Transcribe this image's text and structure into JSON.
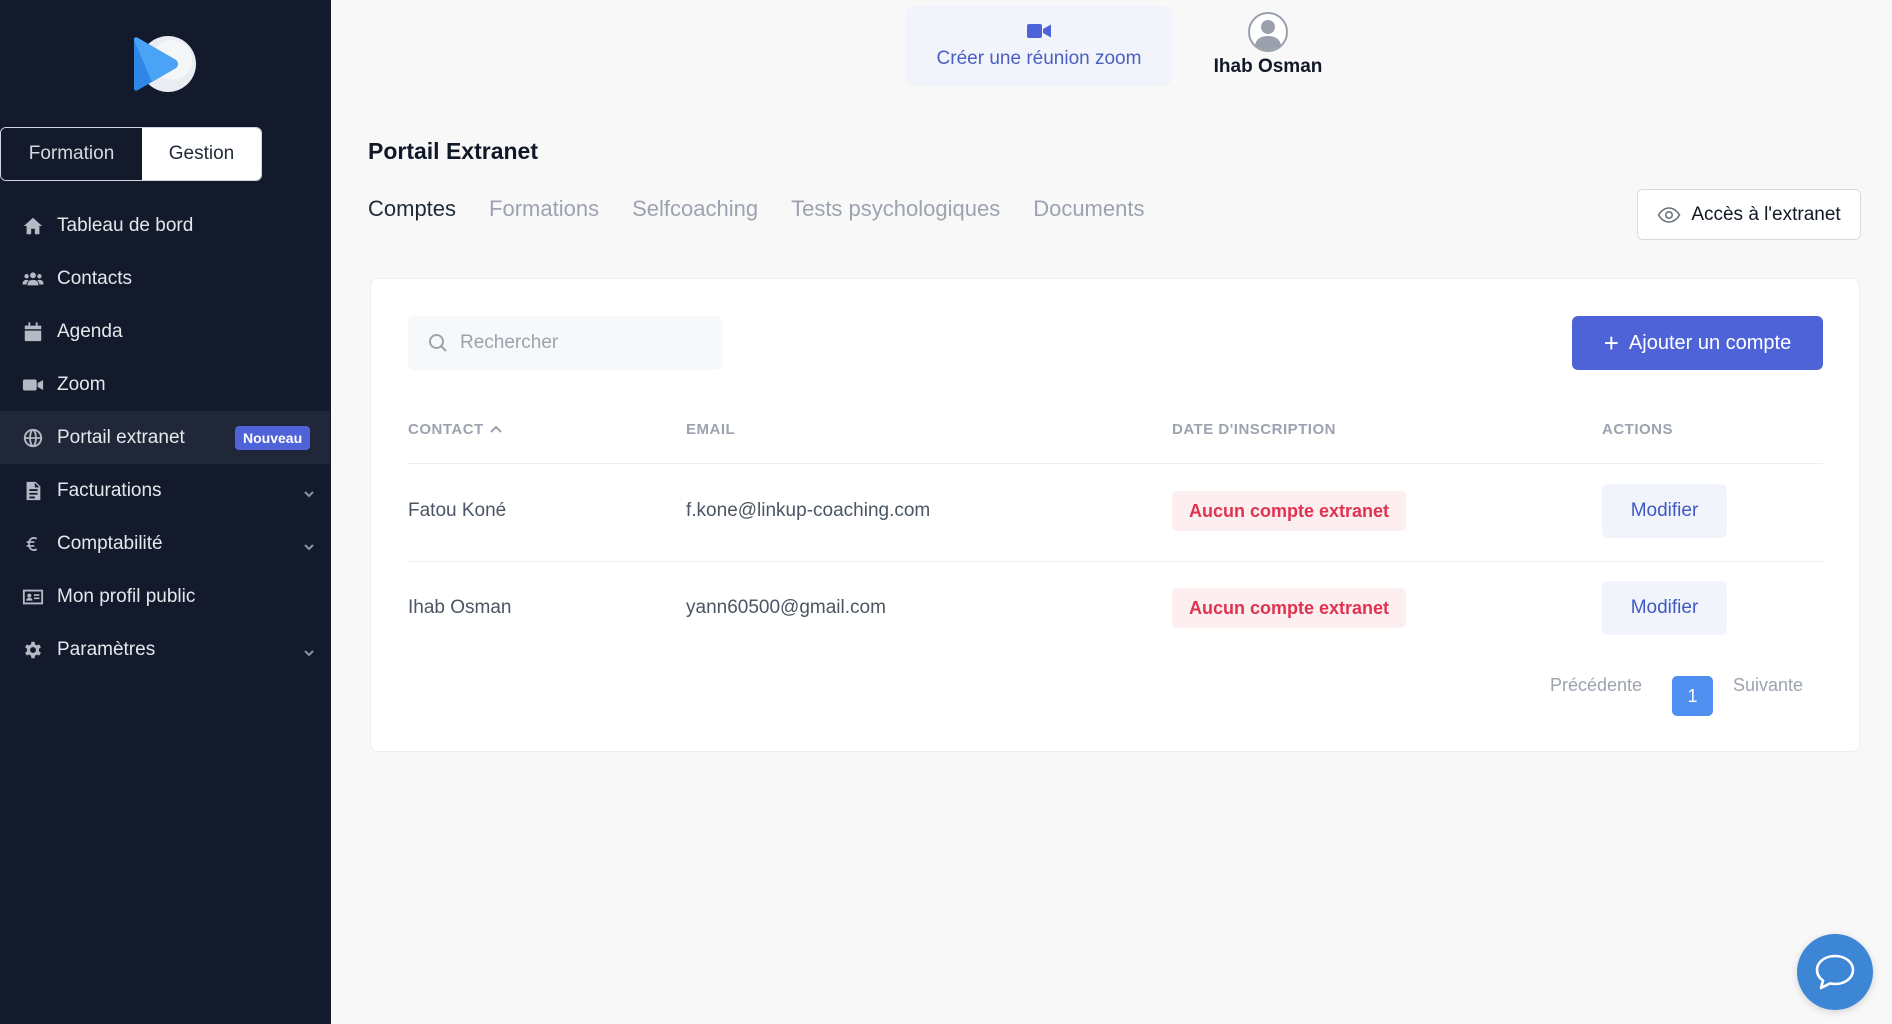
{
  "sidebar": {
    "segments": {
      "formation": "Formation",
      "gestion": "Gestion"
    },
    "items": [
      {
        "label": "Tableau de bord",
        "icon": "home-icon"
      },
      {
        "label": "Contacts",
        "icon": "users-icon"
      },
      {
        "label": "Agenda",
        "icon": "calendar-icon"
      },
      {
        "label": "Zoom",
        "icon": "video-icon"
      },
      {
        "label": "Portail extranet",
        "icon": "globe-icon",
        "badge": "Nouveau",
        "active": true
      },
      {
        "label": "Facturations",
        "icon": "invoice-icon",
        "expandable": true
      },
      {
        "label": "Comptabilité",
        "icon": "euro-icon",
        "expandable": true
      },
      {
        "label": "Mon profil public",
        "icon": "id-card-icon"
      },
      {
        "label": "Paramètres",
        "icon": "gear-icon",
        "expandable": true
      }
    ]
  },
  "topbar": {
    "zoom_button": "Créer une réunion zoom",
    "user_name": "Ihab Osman"
  },
  "page": {
    "title": "Portail Extranet",
    "tabs": [
      "Comptes",
      "Formations",
      "Selfcoaching",
      "Tests psychologiques",
      "Documents"
    ],
    "active_tab": "Comptes",
    "extranet_button": "Accès à l'extranet"
  },
  "accounts": {
    "search_placeholder": "Rechercher",
    "add_button": "Ajouter un compte",
    "columns": [
      "CONTACT",
      "EMAIL",
      "DATE D'INSCRIPTION",
      "ACTIONS"
    ],
    "rows": [
      {
        "contact": "Fatou Koné",
        "email": "f.kone@linkup-coaching.com",
        "status": "Aucun compte extranet",
        "action": "Modifier"
      },
      {
        "contact": "Ihab Osman",
        "email": "yann60500@gmail.com",
        "status": "Aucun compte extranet",
        "action": "Modifier"
      }
    ],
    "pagination": {
      "prev": "Précédente",
      "current": "1",
      "next": "Suivante"
    }
  },
  "colors": {
    "sidebar_bg": "#121a2c",
    "accent": "#4f63d8",
    "status_red": "#e0334f",
    "page_bg": "#f8f8f9"
  }
}
